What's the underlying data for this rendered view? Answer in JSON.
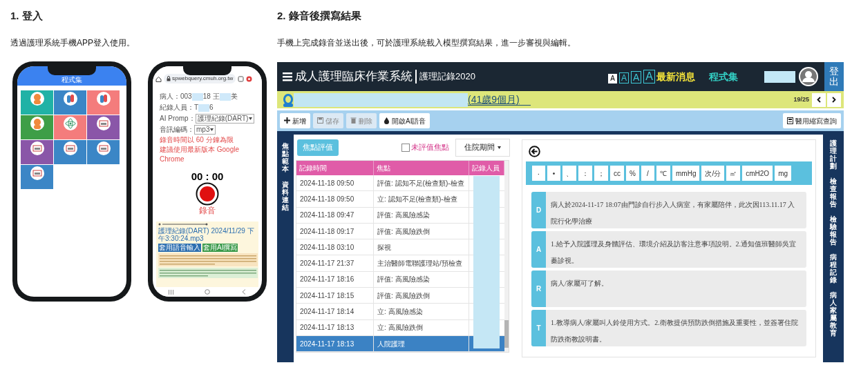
{
  "intro": [
    {
      "heading": "1. 登入",
      "description": "透過護理系統手機APP登入使用。"
    },
    {
      "heading": "2. 錄音後撰寫結果",
      "description": "手機上完成錄音並送出後，可於護理系統載入模型撰寫結果，進一步審視與編輯。"
    }
  ],
  "phone_menu": {
    "title": "程式集",
    "tiles": [
      {
        "color": "#20b2a6",
        "kind": "person"
      },
      {
        "color": "#3b86c6",
        "kind": "pills"
      },
      {
        "color": "#f47c7c",
        "kind": "pills"
      },
      {
        "color": "#3e9e47",
        "kind": "person"
      },
      {
        "color": "#f47c7c",
        "kind": "atom"
      },
      {
        "color": "#8a56a8",
        "kind": "monitor"
      },
      {
        "color": "#8a56a8",
        "kind": "monitor"
      },
      {
        "color": "#3b86c6",
        "kind": "monitor"
      },
      {
        "color": "#3b86c6",
        "kind": "monitor"
      },
      {
        "color": "#3b86c6",
        "kind": "monitor"
      }
    ]
  },
  "phone_recorder": {
    "url": "spwebquery.cmuh.org.tw",
    "fields": [
      {
        "kind": "redacted",
        "label": "病人：",
        "parts": [
          "003",
          "18 王",
          "美"
        ]
      },
      {
        "kind": "redacted",
        "label": "紀錄人員：",
        "parts": [
          "T",
          "6"
        ]
      },
      {
        "kind": "select",
        "label": "AI Promp：",
        "value": "護理紀錄(DART)"
      },
      {
        "kind": "select",
        "label": "音訊編碼：",
        "value": "mp3"
      }
    ],
    "notices": [
      "錄音時間以 60 分鐘為限",
      "建議使用最新版本 Google Chrome"
    ],
    "timer": "00 : 00",
    "record_label": "錄音",
    "file_name": "護理紀錄(DART) 2024/11/29 下午3:30:24.mp3",
    "buttons": [
      {
        "label": "套用語音輸入",
        "color": "#2d6fb0"
      },
      {
        "label": "套用AI撰寫",
        "color": "#3a9a4a"
      }
    ]
  },
  "app": {
    "header": {
      "title": "成人護理臨床作業系統",
      "module": "護理記錄2020",
      "font_sizes": [
        {
          "label": "A",
          "selected": true
        },
        {
          "label": "A",
          "selected": false
        },
        {
          "label": "A",
          "selected": false
        },
        {
          "label": "A",
          "selected": false
        }
      ],
      "news": "最新消息",
      "programs": "程式集",
      "logout": "登出"
    },
    "patient": {
      "age": "(41歲9個月)",
      "position": "19/25"
    },
    "toolbar": {
      "buttons": [
        {
          "label": "新增",
          "kind": "plus",
          "disabled": false
        },
        {
          "label": "儲存",
          "kind": "save",
          "disabled": true
        },
        {
          "label": "刪除",
          "kind": "trash",
          "disabled": true
        },
        {
          "label": "開啟AI語音",
          "kind": "drop",
          "disabled": false
        }
      ],
      "right_button": "醫用縮寫查詢"
    },
    "left_nav": [
      "焦點範本",
      "資料連結"
    ],
    "right_nav": [
      "護理計劃",
      "檢查報告",
      "檢驗報告",
      "病程記錄",
      "病人家屬教育"
    ],
    "focus_panel": {
      "button": "焦點評值",
      "filter": {
        "label": "未評值焦點",
        "checked": false
      },
      "period": "住院期間",
      "columns": [
        "記錄時間",
        "焦點",
        "記錄人員"
      ],
      "rows": [
        {
          "time": "2024-11-18 09:50",
          "focus": "評值: 認知不足(檢查類)-檢查",
          "selected": false
        },
        {
          "time": "2024-11-18 09:50",
          "focus": "立: 認知不足(檢查類)-檢查",
          "selected": false
        },
        {
          "time": "2024-11-18 09:47",
          "focus": "評值: 高風險感染",
          "selected": false
        },
        {
          "time": "2024-11-18 09:17",
          "focus": "評值: 高風險跌倒",
          "selected": false
        },
        {
          "time": "2024-11-18 03:10",
          "focus": "探視",
          "selected": false
        },
        {
          "time": "2024-11-17 21:37",
          "focus": "主治醫師電聯護理站/預檢查",
          "selected": false
        },
        {
          "time": "2024-11-17 18:16",
          "focus": "評值: 高風險感染",
          "selected": false
        },
        {
          "time": "2024-11-17 18:15",
          "focus": "評值: 高風險跌倒",
          "selected": false
        },
        {
          "time": "2024-11-17 18:14",
          "focus": "立: 高風險感染",
          "selected": false
        },
        {
          "time": "2024-11-17 18:13",
          "focus": "立: 高風險跌倒",
          "selected": false
        },
        {
          "time": "2024-11-17 18:13",
          "focus": "人院護理",
          "selected": true
        }
      ]
    },
    "editor": {
      "keys": [
        "‧",
        "•",
        "、",
        "：",
        "；",
        "cc",
        "%",
        "/",
        "℃",
        "mmHg",
        "次/分",
        "㎡",
        "cmH2O",
        "mg"
      ],
      "entries": [
        {
          "letter": "D",
          "text": "病人於2024-11-17 18:07由門診自行步入人病室，有家屬陪伴，此次因113.11.17 入院行化學治療"
        },
        {
          "letter": "A",
          "text": "1.給予入院護理及身體評估、環境介紹及訪客注意事項說明。2.通知值班醫師吳宜蓁診視。"
        },
        {
          "letter": "R",
          "text": "病人/家屬可了解。"
        },
        {
          "letter": "T",
          "text": "1.教導病人/家屬叫人鈴使用方式。2.衛教提供預防跌倒措施及重要性，並簽署住院防跌衛教說明書。"
        }
      ]
    }
  }
}
